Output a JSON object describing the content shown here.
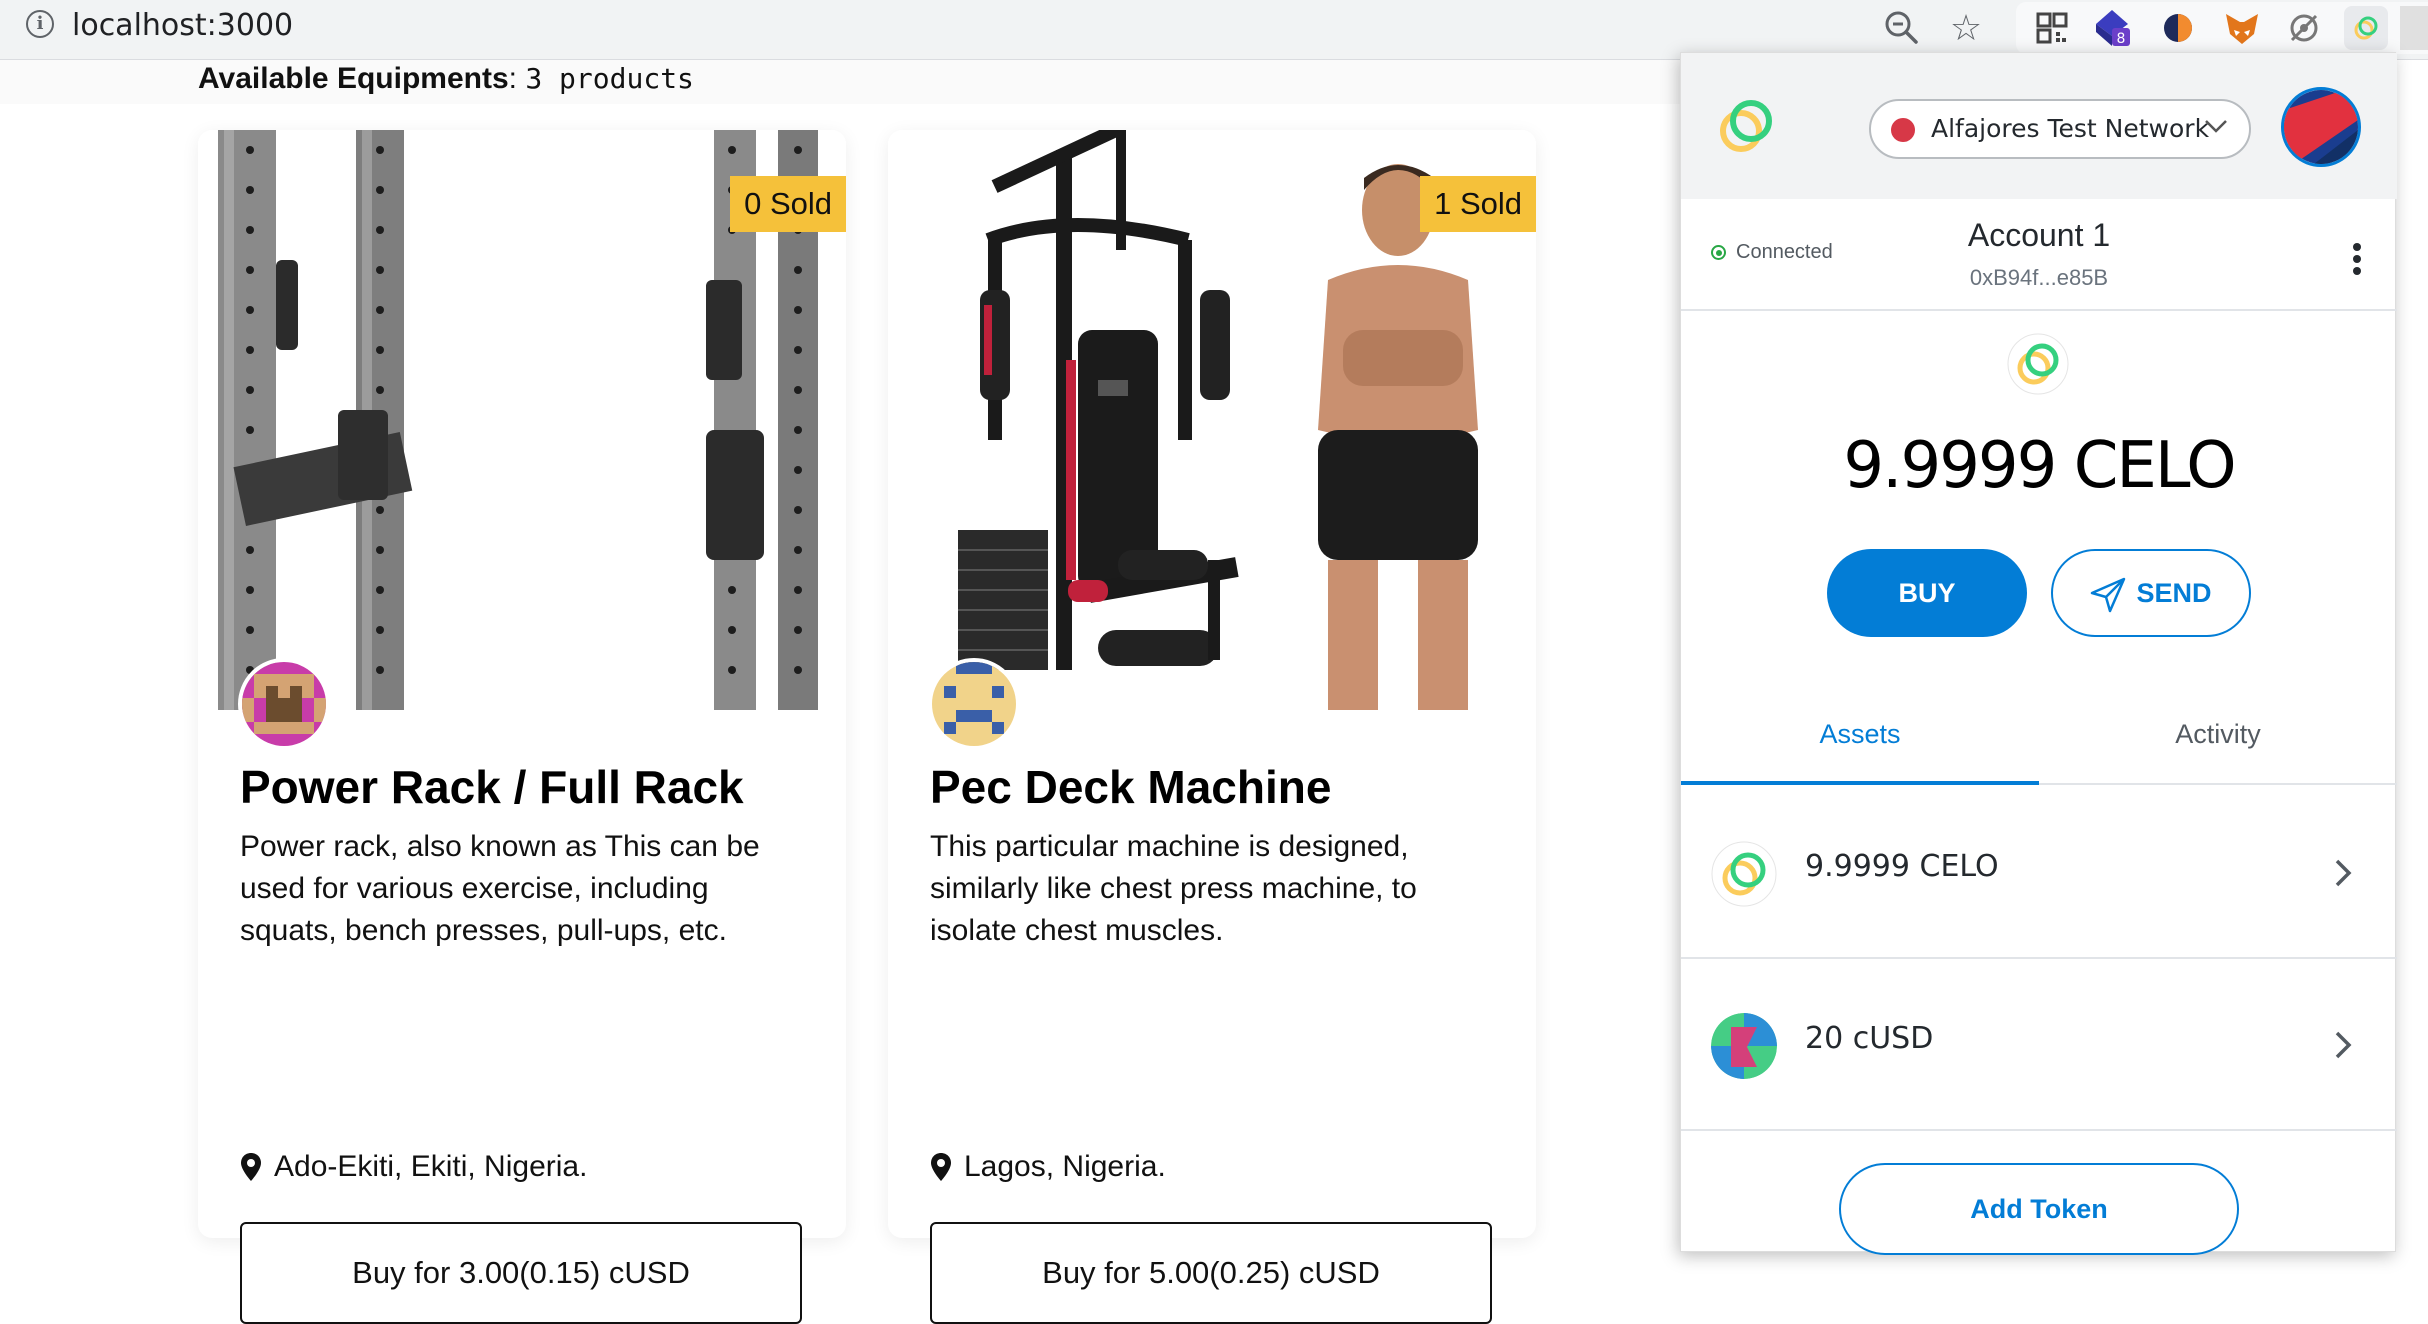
{
  "browser": {
    "url": "localhost:3000"
  },
  "page": {
    "available_label": "Available Equipments",
    "available_sep": ":",
    "available_count": "3 products"
  },
  "products": [
    {
      "sold": "0 Sold",
      "title": "Power Rack / Full Rack",
      "description": "Power rack, also known as This can be used for various exercise, including squats, bench presses, pull-ups, etc.",
      "location": "Ado-Ekiti, Ekiti, Nigeria.",
      "buy_label": "Buy for 3.00(0.15) cUSD"
    },
    {
      "sold": "1 Sold",
      "title": "Pec Deck Machine",
      "description": "This particular machine is designed, similarly like chest press machine, to isolate chest muscles.",
      "location": "Lagos, Nigeria.",
      "buy_label": "Buy for 5.00(0.25) cUSD"
    }
  ],
  "wallet": {
    "network": "Alfajores Test Network",
    "status": "Connected",
    "account_name": "Account 1",
    "account_address": "0xB94f...e85B",
    "balance": "9.9999 CELO",
    "buy_label": "BUY",
    "send_label": "SEND",
    "tabs": [
      "Assets",
      "Activity"
    ],
    "assets": [
      {
        "label": "9.9999 CELO",
        "icon": "celo-icon"
      },
      {
        "label": "20 cUSD",
        "icon": "cusd-icon"
      }
    ],
    "add_token_label": "Add Token"
  },
  "colors": {
    "accent": "#037dd6",
    "sold_badge": "#f5c13a",
    "network_dot": "#d73847",
    "connected": "#28a745"
  },
  "icons": [
    "info-icon",
    "zoom-icon",
    "star-icon",
    "qr-icon",
    "extension-icon",
    "metamask-fox-icon",
    "puzzle-icon",
    "celo-extension-icon",
    "location-pin-icon",
    "chevron-down-icon",
    "chevron-right-icon",
    "send-arrow-icon",
    "kebab-menu-icon"
  ]
}
